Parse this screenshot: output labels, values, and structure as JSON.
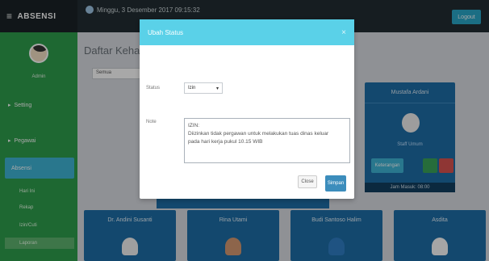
{
  "app": {
    "brand": "ABSENSI",
    "menu_glyph": "≡",
    "top_title": "Minggu, 3 Desember 2017 09:15:32",
    "top_button": "Logout"
  },
  "sidebar": {
    "user": "Admin",
    "items": [
      {
        "label": "Setting",
        "glyph": "▸"
      },
      {
        "label": "Pegawai",
        "glyph": "▸"
      }
    ],
    "active": "Absensi",
    "submenu": [
      "Hari Ini",
      "Rekap",
      "Izin/Cuti",
      "Laporan"
    ],
    "submenu_selected": 3
  },
  "content": {
    "title": "Daftar Kehadiran",
    "select_value": "Semua"
  },
  "card_right": {
    "title": "Mustafa Ardani",
    "name": "Staff Umum",
    "edit_label": "Keterangan",
    "footer": "Jam Masuk: 08:00"
  },
  "bottom_cards": [
    {
      "title": "Dr. Andini Susanti",
      "color": "#f1f1f1"
    },
    {
      "title": "Rina Utami",
      "color": "#d79a72"
    },
    {
      "title": "Budi Santoso Halim",
      "color": "#2f7fc6"
    },
    {
      "title": "Asdita",
      "color": "#fafafa"
    }
  ],
  "modal": {
    "title": "Ubah Status",
    "close_glyph": "×",
    "status_label": "Status",
    "status_value": "Izin",
    "dropdown_glyph": "▾",
    "note_label": "Note",
    "note_text": "IZIN:\nDiizinkan tidak pergawan untuk melakukan tuas dinas keluar\npada hari kerja pukul 10.15 WIB",
    "close_button": "Close",
    "save_button": "Simpan"
  }
}
